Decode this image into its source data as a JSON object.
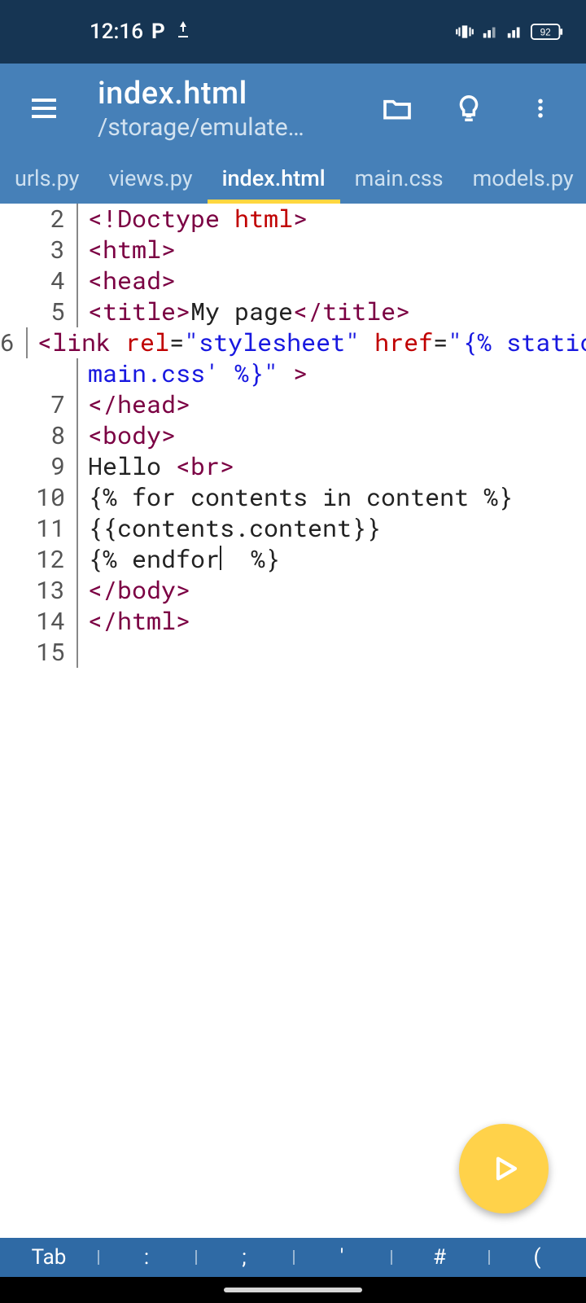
{
  "statusbar": {
    "time": "12:16",
    "battery": "92"
  },
  "appbar": {
    "title": "index.html",
    "path": "/storage/emulate…"
  },
  "tabs": [
    "urls.py",
    "views.py",
    "index.html",
    "main.css",
    "models.py"
  ],
  "active_tab": 2,
  "line_start": 2,
  "code_lines": [
    [
      {
        "c": "tag",
        "t": "<!Doctype"
      },
      {
        "c": "text",
        "t": " "
      },
      {
        "c": "attr",
        "t": "html"
      },
      {
        "c": "tag",
        "t": ">"
      }
    ],
    [
      {
        "c": "tag",
        "t": "<html>"
      }
    ],
    [
      {
        "c": "tag",
        "t": "<head>"
      }
    ],
    [
      {
        "c": "tag",
        "t": "<title>"
      },
      {
        "c": "text",
        "t": "My page"
      },
      {
        "c": "tag",
        "t": "</title>"
      }
    ],
    [
      {
        "c": "tag",
        "t": "<link"
      },
      {
        "c": "text",
        "t": " "
      },
      {
        "c": "attr",
        "t": "rel"
      },
      {
        "c": "text",
        "t": "="
      },
      {
        "c": "str",
        "t": "\"stylesheet\""
      },
      {
        "c": "text",
        "t": " "
      },
      {
        "c": "attr",
        "t": "href"
      },
      {
        "c": "text",
        "t": "="
      },
      {
        "c": "str",
        "t": "\"{% static 'todo/"
      }
    ],
    [
      {
        "c": "str",
        "t": "main.css' %}\""
      },
      {
        "c": "text",
        "t": " "
      },
      {
        "c": "tag",
        "t": ">"
      }
    ],
    [
      {
        "c": "tag",
        "t": "</head>"
      }
    ],
    [
      {
        "c": "tag",
        "t": "<body>"
      }
    ],
    [
      {
        "c": "text",
        "t": "Hello "
      },
      {
        "c": "tag",
        "t": "<br>"
      }
    ],
    [
      {
        "c": "text",
        "t": "{% for contents in content %}"
      }
    ],
    [
      {
        "c": "text",
        "t": "{{contents.content}}"
      }
    ],
    [
      {
        "c": "text",
        "t": "{% endfor"
      },
      {
        "c": "cursor",
        "t": ""
      },
      {
        "c": "text",
        "t": "  %}"
      }
    ],
    [
      {
        "c": "tag",
        "t": "</body>"
      }
    ],
    [
      {
        "c": "tag",
        "t": "</html>"
      }
    ],
    []
  ],
  "keyrow": [
    "Tab",
    ":",
    ";",
    "'",
    "#",
    "("
  ]
}
